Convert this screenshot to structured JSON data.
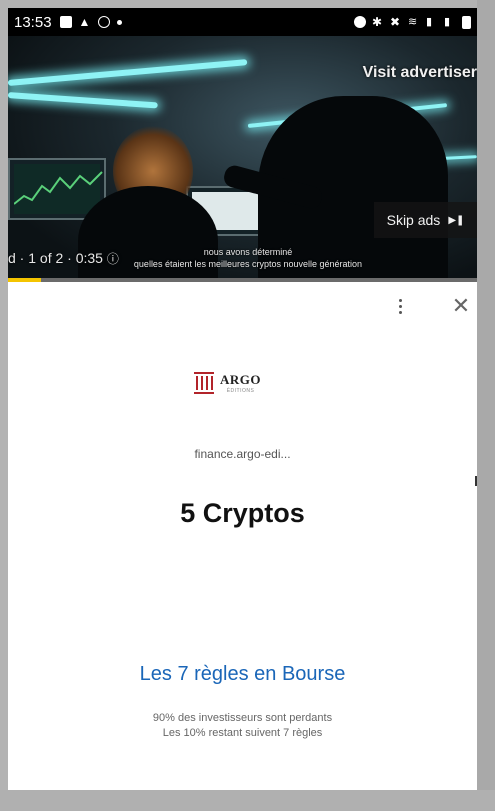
{
  "status_bar": {
    "time": "13:53"
  },
  "video": {
    "visit_advertiser": "Visit advertiser",
    "skip_label": "Skip ads",
    "ad_progress": "d · 1 of 2 · 0:35",
    "subtitle_line1": "nous avons déterminé",
    "subtitle_line2": "quelles étaient les meilleures cryptos nouvelle génération",
    "progress": 0.07
  },
  "ad": {
    "logo_name": "ARGO",
    "logo_sub": "ÉDITIONS",
    "domain": "finance.argo-edi...",
    "headline": "5 Cryptos",
    "cta_title": "Les 7 règles en Bourse",
    "cta_line1": "90% des investisseurs sont perdants",
    "cta_line2": "Les 10% restant suivent 7 règles"
  },
  "colors": {
    "accent_progress": "#f4c400",
    "cta_blue": "#1a66b8",
    "logo_red": "#b2242a"
  }
}
